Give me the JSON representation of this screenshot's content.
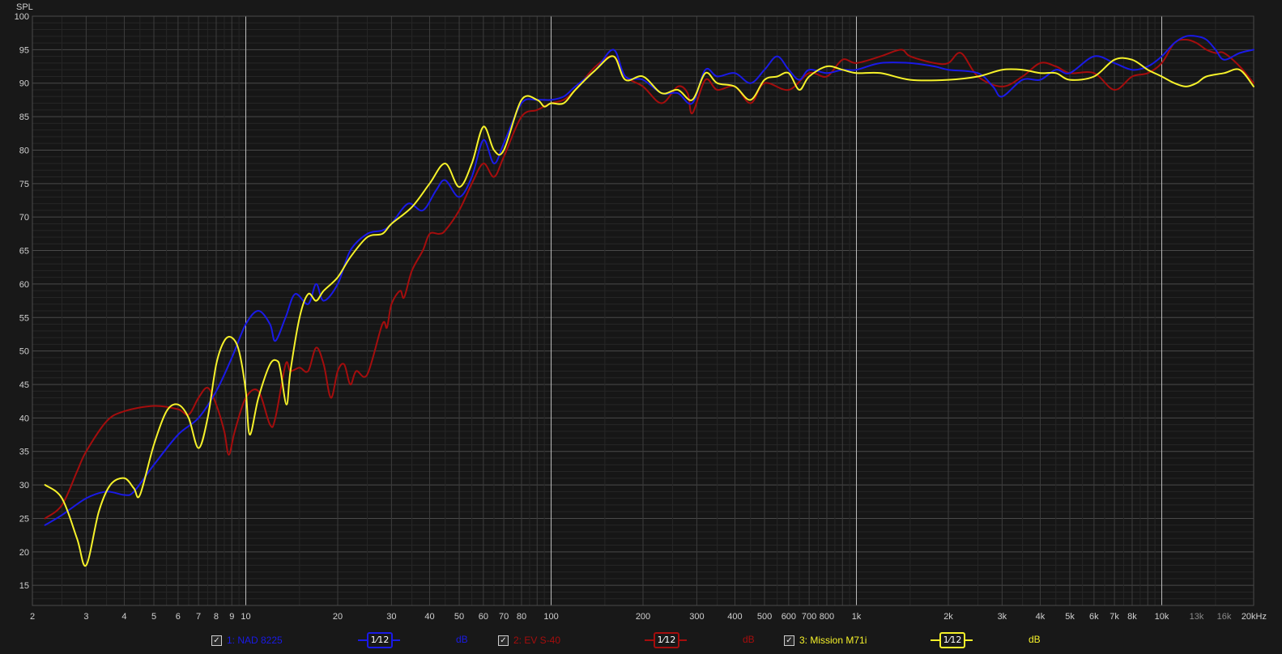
{
  "chart_data": {
    "type": "line",
    "ylabel": "SPL",
    "xscale": "log",
    "xlim": [
      2,
      20000
    ],
    "ylim": [
      12,
      100
    ],
    "grid": true,
    "y_ticks": [
      15,
      20,
      25,
      30,
      35,
      40,
      45,
      50,
      55,
      60,
      65,
      70,
      75,
      80,
      85,
      90,
      95,
      100
    ],
    "x_ticks": [
      {
        "v": 2,
        "label": "2"
      },
      {
        "v": 3,
        "label": "3"
      },
      {
        "v": 4,
        "label": "4"
      },
      {
        "v": 5,
        "label": "5"
      },
      {
        "v": 6,
        "label": "6"
      },
      {
        "v": 7,
        "label": "7"
      },
      {
        "v": 8,
        "label": "8"
      },
      {
        "v": 9,
        "label": "9"
      },
      {
        "v": 10,
        "label": "10"
      },
      {
        "v": 20,
        "label": "20"
      },
      {
        "v": 30,
        "label": "30"
      },
      {
        "v": 40,
        "label": "40"
      },
      {
        "v": 50,
        "label": "50"
      },
      {
        "v": 60,
        "label": "60"
      },
      {
        "v": 70,
        "label": "70"
      },
      {
        "v": 80,
        "label": "80"
      },
      {
        "v": 100,
        "label": "100"
      },
      {
        "v": 200,
        "label": "200"
      },
      {
        "v": 300,
        "label": "300"
      },
      {
        "v": 400,
        "label": "400"
      },
      {
        "v": 500,
        "label": "500"
      },
      {
        "v": 600,
        "label": "600"
      },
      {
        "v": 700,
        "label": "700"
      },
      {
        "v": 800,
        "label": "800"
      },
      {
        "v": 1000,
        "label": "1k"
      },
      {
        "v": 2000,
        "label": "2k"
      },
      {
        "v": 3000,
        "label": "3k"
      },
      {
        "v": 4000,
        "label": "4k"
      },
      {
        "v": 5000,
        "label": "5k"
      },
      {
        "v": 6000,
        "label": "6k"
      },
      {
        "v": 7000,
        "label": "7k"
      },
      {
        "v": 8000,
        "label": "8k"
      },
      {
        "v": 10000,
        "label": "10k"
      },
      {
        "v": 13000,
        "label": "13k"
      },
      {
        "v": 16000,
        "label": "16k"
      },
      {
        "v": 20000,
        "label": "20kHz"
      }
    ],
    "series": [
      {
        "name": "1: NAD 8225",
        "color": "#1a1ae6",
        "smoothing": "1/12",
        "unit": "dB",
        "points": [
          [
            2.2,
            24
          ],
          [
            2.5,
            25.5
          ],
          [
            3,
            28
          ],
          [
            3.5,
            29
          ],
          [
            4,
            28.5
          ],
          [
            4.3,
            29
          ],
          [
            5,
            33
          ],
          [
            6,
            37.5
          ],
          [
            7,
            40
          ],
          [
            8,
            44
          ],
          [
            9,
            49
          ],
          [
            10,
            54
          ],
          [
            11,
            56
          ],
          [
            12,
            54
          ],
          [
            12.5,
            51.5
          ],
          [
            13.5,
            55
          ],
          [
            14.5,
            58.5
          ],
          [
            16,
            57
          ],
          [
            17,
            60
          ],
          [
            18,
            57.5
          ],
          [
            20,
            60
          ],
          [
            22,
            65
          ],
          [
            25,
            67.5
          ],
          [
            28,
            68
          ],
          [
            30,
            69
          ],
          [
            34,
            72
          ],
          [
            38,
            71
          ],
          [
            42,
            74
          ],
          [
            45,
            75.5
          ],
          [
            50,
            73
          ],
          [
            55,
            76
          ],
          [
            60,
            81.5
          ],
          [
            65,
            78
          ],
          [
            70,
            81
          ],
          [
            80,
            87
          ],
          [
            90,
            87.5
          ],
          [
            100,
            87.5
          ],
          [
            110,
            88
          ],
          [
            120,
            89.5
          ],
          [
            140,
            92
          ],
          [
            160,
            95
          ],
          [
            175,
            91
          ],
          [
            200,
            90.5
          ],
          [
            230,
            88.5
          ],
          [
            260,
            88.5
          ],
          [
            290,
            87
          ],
          [
            320,
            92
          ],
          [
            350,
            91
          ],
          [
            400,
            91.5
          ],
          [
            450,
            90
          ],
          [
            500,
            92
          ],
          [
            550,
            94
          ],
          [
            600,
            92
          ],
          [
            650,
            90.5
          ],
          [
            700,
            92
          ],
          [
            800,
            91.5
          ],
          [
            900,
            92
          ],
          [
            1000,
            92
          ],
          [
            1200,
            93
          ],
          [
            1500,
            93
          ],
          [
            1800,
            92.5
          ],
          [
            2000,
            92
          ],
          [
            2500,
            91.5
          ],
          [
            2800,
            89.5
          ],
          [
            3000,
            88
          ],
          [
            3500,
            90.5
          ],
          [
            4000,
            90.5
          ],
          [
            4500,
            92
          ],
          [
            5000,
            91.5
          ],
          [
            6000,
            94
          ],
          [
            7000,
            93
          ],
          [
            8000,
            92
          ],
          [
            9000,
            92.5
          ],
          [
            10000,
            94
          ],
          [
            11000,
            96
          ],
          [
            12000,
            97
          ],
          [
            13000,
            97
          ],
          [
            14000,
            96.5
          ],
          [
            15000,
            95
          ],
          [
            16000,
            93.5
          ],
          [
            18000,
            94.5
          ],
          [
            20000,
            95
          ]
        ]
      },
      {
        "name": "2: EV S-40",
        "color": "#a50d0d",
        "smoothing": "1/12",
        "unit": "dB",
        "points": [
          [
            2.2,
            25
          ],
          [
            2.5,
            27
          ],
          [
            2.8,
            32
          ],
          [
            3,
            35
          ],
          [
            3.5,
            39.5
          ],
          [
            4,
            41
          ],
          [
            5,
            41.8
          ],
          [
            6,
            41.3
          ],
          [
            6.5,
            40.5
          ],
          [
            7,
            43
          ],
          [
            7.5,
            44.5
          ],
          [
            8,
            42
          ],
          [
            8.5,
            38
          ],
          [
            8.8,
            34.5
          ],
          [
            9.2,
            38
          ],
          [
            10,
            43
          ],
          [
            11,
            44
          ],
          [
            12,
            39
          ],
          [
            12.5,
            40
          ],
          [
            13.5,
            48
          ],
          [
            14,
            47
          ],
          [
            15,
            47.5
          ],
          [
            16,
            47
          ],
          [
            17,
            50.5
          ],
          [
            18,
            48
          ],
          [
            19,
            43
          ],
          [
            20,
            47
          ],
          [
            21,
            48
          ],
          [
            22,
            45
          ],
          [
            23,
            47
          ],
          [
            25,
            46.5
          ],
          [
            28,
            54
          ],
          [
            29,
            53.5
          ],
          [
            30,
            57
          ],
          [
            32,
            59
          ],
          [
            33,
            58
          ],
          [
            35,
            62
          ],
          [
            38,
            65
          ],
          [
            40,
            67.5
          ],
          [
            43,
            67.5
          ],
          [
            45,
            68
          ],
          [
            50,
            71
          ],
          [
            55,
            75
          ],
          [
            60,
            78
          ],
          [
            65,
            76
          ],
          [
            70,
            79
          ],
          [
            80,
            85
          ],
          [
            90,
            86
          ],
          [
            100,
            87
          ],
          [
            110,
            87.5
          ],
          [
            120,
            89
          ],
          [
            140,
            92.5
          ],
          [
            160,
            94
          ],
          [
            175,
            91
          ],
          [
            200,
            89.5
          ],
          [
            230,
            87
          ],
          [
            260,
            89.5
          ],
          [
            280,
            88.5
          ],
          [
            290,
            85.5
          ],
          [
            320,
            90.5
          ],
          [
            350,
            89
          ],
          [
            400,
            89.5
          ],
          [
            450,
            87
          ],
          [
            500,
            90
          ],
          [
            600,
            89
          ],
          [
            700,
            91.5
          ],
          [
            800,
            91
          ],
          [
            900,
            93.5
          ],
          [
            1000,
            93
          ],
          [
            1200,
            94
          ],
          [
            1400,
            95
          ],
          [
            1500,
            94
          ],
          [
            1800,
            93
          ],
          [
            2000,
            93
          ],
          [
            2200,
            94.5
          ],
          [
            2500,
            91
          ],
          [
            3000,
            89.5
          ],
          [
            3500,
            91
          ],
          [
            4000,
            93
          ],
          [
            4500,
            92.5
          ],
          [
            5000,
            91.5
          ],
          [
            6000,
            91.5
          ],
          [
            7000,
            89
          ],
          [
            8000,
            91
          ],
          [
            9000,
            91.5
          ],
          [
            10000,
            93
          ],
          [
            11000,
            96
          ],
          [
            12000,
            96.5
          ],
          [
            13000,
            96
          ],
          [
            14000,
            95
          ],
          [
            15000,
            94.5
          ],
          [
            16000,
            94.5
          ],
          [
            18000,
            92.5
          ],
          [
            20000,
            90
          ]
        ]
      },
      {
        "name": "3: Mission M71i",
        "color": "#f6f22a",
        "smoothing": "1/12",
        "unit": "dB",
        "points": [
          [
            2.2,
            30
          ],
          [
            2.5,
            28
          ],
          [
            2.8,
            22
          ],
          [
            3,
            18
          ],
          [
            3.3,
            26
          ],
          [
            3.6,
            30
          ],
          [
            4,
            31
          ],
          [
            4.3,
            29.5
          ],
          [
            4.5,
            28.5
          ],
          [
            5,
            36
          ],
          [
            5.5,
            41
          ],
          [
            6,
            42
          ],
          [
            6.5,
            40
          ],
          [
            7,
            35.5
          ],
          [
            7.5,
            40
          ],
          [
            8,
            48
          ],
          [
            8.5,
            51.5
          ],
          [
            9,
            52
          ],
          [
            9.5,
            50
          ],
          [
            10,
            44
          ],
          [
            10.3,
            37.5
          ],
          [
            11,
            43
          ],
          [
            12,
            48
          ],
          [
            12.7,
            48.5
          ],
          [
            13,
            47
          ],
          [
            13.6,
            42
          ],
          [
            14,
            47
          ],
          [
            15,
            55
          ],
          [
            16,
            58.5
          ],
          [
            17,
            57.5
          ],
          [
            18,
            59
          ],
          [
            20,
            61
          ],
          [
            22,
            64
          ],
          [
            25,
            67
          ],
          [
            28,
            67.5
          ],
          [
            30,
            69
          ],
          [
            35,
            71.5
          ],
          [
            40,
            75
          ],
          [
            45,
            78
          ],
          [
            50,
            74.5
          ],
          [
            55,
            78
          ],
          [
            60,
            83.5
          ],
          [
            65,
            80
          ],
          [
            70,
            80
          ],
          [
            80,
            87.5
          ],
          [
            90,
            87.5
          ],
          [
            95,
            86.5
          ],
          [
            100,
            87
          ],
          [
            110,
            87
          ],
          [
            120,
            89
          ],
          [
            140,
            92
          ],
          [
            160,
            94
          ],
          [
            175,
            90.5
          ],
          [
            200,
            91
          ],
          [
            230,
            88.5
          ],
          [
            260,
            89
          ],
          [
            290,
            87.5
          ],
          [
            320,
            91.5
          ],
          [
            350,
            90
          ],
          [
            400,
            89.5
          ],
          [
            450,
            87.5
          ],
          [
            500,
            90.5
          ],
          [
            550,
            91
          ],
          [
            600,
            91.5
          ],
          [
            650,
            89
          ],
          [
            700,
            91
          ],
          [
            800,
            92.5
          ],
          [
            900,
            92
          ],
          [
            1000,
            91.5
          ],
          [
            1200,
            91.5
          ],
          [
            1500,
            90.5
          ],
          [
            2000,
            90.5
          ],
          [
            2500,
            91
          ],
          [
            3000,
            92
          ],
          [
            3500,
            92
          ],
          [
            4000,
            91.5
          ],
          [
            4500,
            91.5
          ],
          [
            5000,
            90.5
          ],
          [
            6000,
            91
          ],
          [
            7000,
            93.5
          ],
          [
            8000,
            93.5
          ],
          [
            9000,
            92
          ],
          [
            10000,
            91
          ],
          [
            11000,
            90
          ],
          [
            12000,
            89.5
          ],
          [
            13000,
            90
          ],
          [
            14000,
            91
          ],
          [
            16000,
            91.5
          ],
          [
            18000,
            92
          ],
          [
            20000,
            89.5
          ]
        ]
      }
    ]
  },
  "legend": {
    "items": [
      {
        "check": "✓",
        "label": "1: NAD 8225",
        "smoothing": "1⁄12",
        "unit": "dB"
      },
      {
        "check": "✓",
        "label": "2: EV S-40",
        "smoothing": "1⁄12",
        "unit": "dB"
      },
      {
        "check": "✓",
        "label": "3: Mission M71i",
        "smoothing": "1⁄12",
        "unit": "dB"
      }
    ]
  },
  "colors": {
    "background": "#181818",
    "series1": "#1a1ae6",
    "series2": "#a50d0d",
    "series3": "#f6f22a",
    "grid": "#3a3a3a",
    "grid_major": "#bdbdbd",
    "text": "#d0d0d0"
  }
}
